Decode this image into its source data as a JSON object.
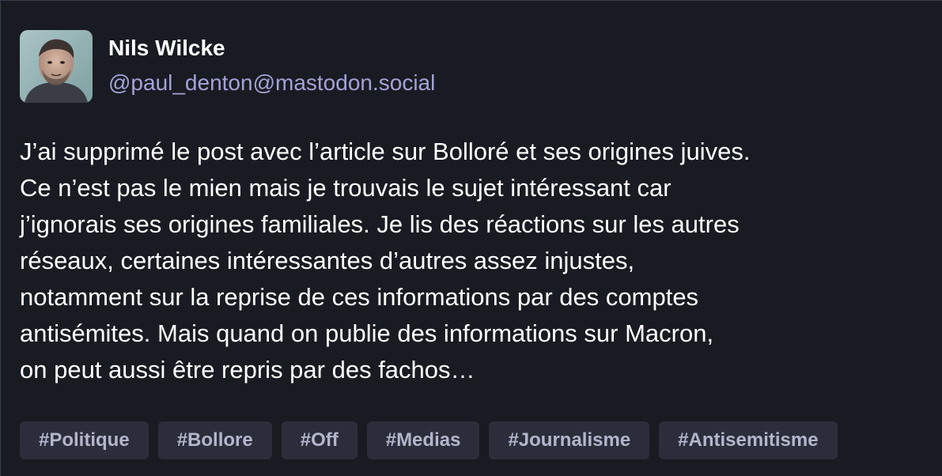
{
  "author": {
    "display_name": "Nils Wilcke",
    "handle": "@paul_denton@mastodon.social"
  },
  "content": {
    "lines": [
      "J’ai supprimé le post avec l’article sur Bolloré et ses origines juives.",
      "Ce n’est pas le mien mais je trouvais le sujet intéressant car",
      "j’ignorais ses origines familiales. Je lis des réactions sur les autres",
      "réseaux, certaines intéressantes d’autres assez injustes,",
      "notamment sur la reprise de ces informations par des comptes",
      "antisémites. Mais quand on publie des informations sur Macron,",
      "on peut aussi être repris par des fachos…"
    ]
  },
  "tags": [
    "#Politique",
    "#Bollore",
    "#Off",
    "#Medias",
    "#Journalisme",
    "#Antisemitisme"
  ],
  "colors": {
    "background": "#191b22",
    "handle": "#a3a3d8",
    "tag_background": "#2b2d3a",
    "tag_text": "#b3b6cc"
  }
}
